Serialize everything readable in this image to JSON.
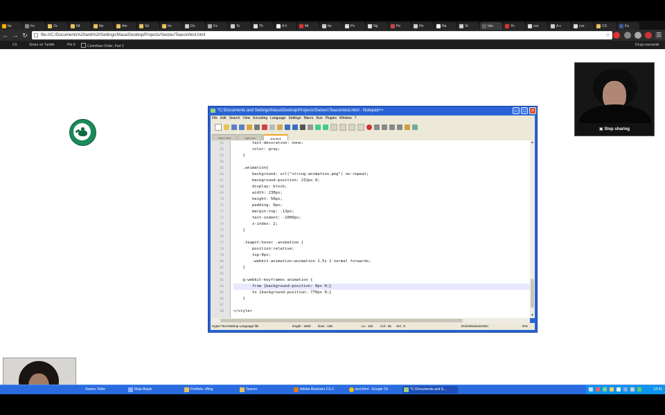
{
  "browser": {
    "tabs": [
      "fur",
      "Iro",
      "Za",
      "IM",
      "Ne",
      "Am",
      "Str",
      "Im",
      "Do",
      "Fa",
      "To",
      "Th",
      "A h",
      "Mr",
      "fur",
      "Po",
      "Ng",
      "Pe",
      "Ho",
      "Na",
      "St",
      "bits",
      "Yo",
      "css",
      "A c",
      "css",
      "CS",
      "Fa"
    ],
    "address": "file:///C:/Documents%20and%20Settings/Masa/Desktop/Projects/Swizec/Teacon/test.html",
    "bookmarks": [
      "Cit",
      "Share on Tumblr",
      "Pin It",
      "Corinthian Order, Part 2"
    ],
    "other_bookmarks": "Drugi zaznamki"
  },
  "webcam": {
    "stop_sharing": "Stop sharing"
  },
  "notepad": {
    "title": "*C:\\Documents and Settings\\Masa\\Desktop\\Projects\\Swizec\\Teacon\\test.html - Notepad++",
    "menu": [
      "File",
      "Edit",
      "Search",
      "View",
      "Encoding",
      "Language",
      "Settings",
      "Macro",
      "Run",
      "Plugins",
      "Window",
      "?"
    ],
    "doc_tabs": [
      "index.html",
      "style.css",
      "test.html"
    ],
    "code_lines": [
      {
        "n": "61",
        "t": "        text-decoration: none;"
      },
      {
        "n": "62",
        "t": "        color: gray;"
      },
      {
        "n": "63",
        "t": "    }"
      },
      {
        "n": "64",
        "t": ""
      },
      {
        "n": "65",
        "t": "    .animation{"
      },
      {
        "n": "66",
        "t": "        background: url(\"string-animation.png\") no-repeat;"
      },
      {
        "n": "67",
        "t": "        background-position: 231px 0;"
      },
      {
        "n": "68",
        "t": "        display: block;"
      },
      {
        "n": "69",
        "t": "        width: 230px;"
      },
      {
        "n": "70",
        "t": "        height: 50px;"
      },
      {
        "n": "71",
        "t": "        padding: 0px;"
      },
      {
        "n": "72",
        "t": "        margin-top: -13px;"
      },
      {
        "n": "73",
        "t": "        text-indent: -1000px;"
      },
      {
        "n": "74",
        "t": "        z-index: 2;"
      },
      {
        "n": "75",
        "t": "    }"
      },
      {
        "n": "76",
        "t": ""
      },
      {
        "n": "77",
        "t": "    .teapot:hover .animation {"
      },
      {
        "n": "78",
        "t": "        position:relative;"
      },
      {
        "n": "79",
        "t": "        top:0px;"
      },
      {
        "n": "80",
        "t": "        -webkit-animation:animation 1.5s 1 normal forwards;"
      },
      {
        "n": "81",
        "t": "    }"
      },
      {
        "n": "82",
        "t": ""
      },
      {
        "n": "83",
        "t": "    @-webkit-keyframes animation {"
      },
      {
        "n": "84",
        "t": "        from {background-position: 0px 0;}"
      },
      {
        "n": "85",
        "t": "        to {background-position:-770px 0;}"
      },
      {
        "n": "86",
        "t": "    }"
      },
      {
        "n": "87",
        "t": ""
      },
      {
        "n": "88",
        "t": "</style>"
      }
    ],
    "status": {
      "type": "Hyper Text Markup Language file",
      "length": "length : 1993",
      "lines": "lines : 108",
      "pos": "Ln : 104",
      "col": "Col : 35",
      "sel": "Sel : 0",
      "eol": "Dos\\Windows",
      "enc": "ANSI",
      "mode": "INS"
    }
  },
  "taskbar": {
    "items": [
      "Swizec Teller",
      "Maja Bizjak",
      "Portfolio »Blog",
      "Teacon",
      "Adobe Illustrator CS-1",
      "test.html - Google Ch",
      "*C:\\Documents and S..."
    ],
    "clock": "12:41"
  }
}
